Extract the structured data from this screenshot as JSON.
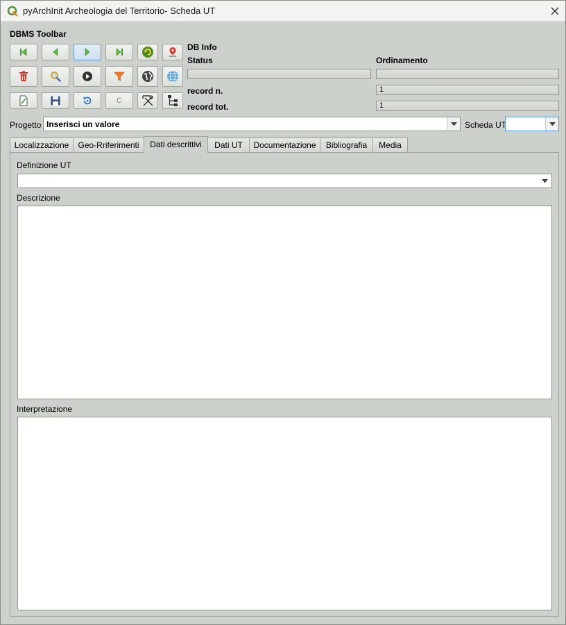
{
  "window": {
    "title": "pyArchInit Archeologia del Territorio- Scheda UT"
  },
  "toolbar": {
    "title": "DBMS Toolbar",
    "buttons": [
      {
        "icon": "first-record-icon"
      },
      {
        "icon": "previous-record-icon"
      },
      {
        "icon": "next-record-icon"
      },
      {
        "icon": "last-record-icon"
      },
      {
        "icon": "refresh-sync-icon"
      },
      {
        "icon": "map-pin-icon"
      },
      {
        "icon": "delete-icon"
      },
      {
        "icon": "search-icon"
      },
      {
        "icon": "run-icon"
      },
      {
        "icon": "filter-icon"
      },
      {
        "icon": "world-icon"
      },
      {
        "icon": "globe-icon"
      },
      {
        "icon": "new-record-icon"
      },
      {
        "icon": "save-icon"
      },
      {
        "icon": "reload-icon"
      },
      {
        "icon": "c-icon",
        "label": "C"
      },
      {
        "icon": "tools-icon"
      },
      {
        "icon": "tree-icon"
      }
    ]
  },
  "db_info": {
    "title": "DB Info",
    "status_label": "Status",
    "status_value": "",
    "ordinamento_label": "Ordinamento",
    "ordinamento_value": "",
    "record_n_label": "record n.",
    "record_n_value": "1",
    "record_tot_label": "record tot.",
    "record_tot_value": "1"
  },
  "progetto": {
    "label": "Progetto",
    "value": "Inserisci un valore"
  },
  "scheda_ut": {
    "label": "Scheda UT",
    "value": ""
  },
  "tabs": [
    {
      "label": "Localizzazione"
    },
    {
      "label": "Geo-Rriferimenti"
    },
    {
      "label": "Dati descrittivi",
      "active": true
    },
    {
      "label": "Dati UT"
    },
    {
      "label": "Documentazione"
    },
    {
      "label": "Bibliografia"
    },
    {
      "label": "Media"
    }
  ],
  "panel": {
    "definizione_label": "Definizione UT",
    "definizione_value": "",
    "descrizione_label": "Descrizione",
    "descrizione_value": "",
    "interpretazione_label": "Interpretazione",
    "interpretazione_value": ""
  },
  "colors": {
    "window_bg": "#cdd1cb",
    "active_button_border": "#5b9bd5"
  }
}
